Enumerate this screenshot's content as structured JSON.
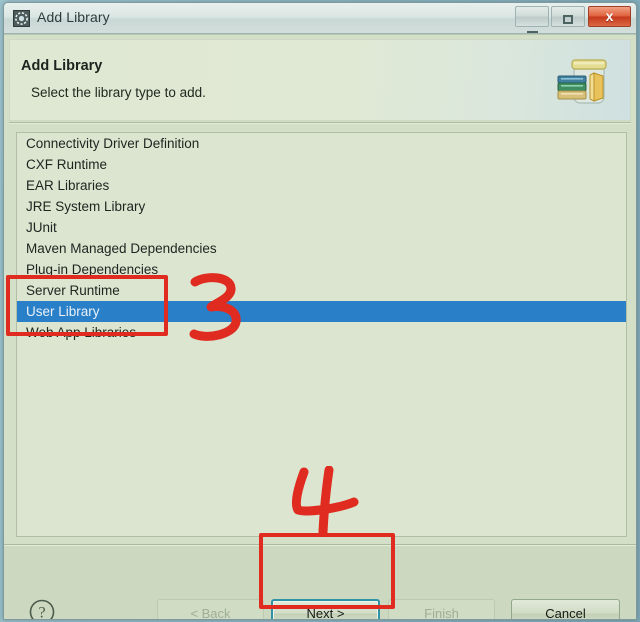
{
  "window": {
    "title": "Add Library",
    "icon": "eclipse-wizard-icon",
    "controls": {
      "minimize_label": "–",
      "maximize_label": "□",
      "close_label": "x"
    }
  },
  "banner": {
    "title": "Add Library",
    "description": "Select the library type to add.",
    "icon": "jar-library-icon"
  },
  "list": {
    "name": "library-type-list",
    "selected_index": 8,
    "items": [
      "Connectivity Driver Definition",
      "CXF Runtime",
      "EAR Libraries",
      "JRE System Library",
      "JUnit",
      "Maven Managed Dependencies",
      "Plug-in Dependencies",
      "Server Runtime",
      "User Library",
      "Web App Libraries"
    ]
  },
  "buttons": {
    "help_icon": "help-question-icon",
    "back": {
      "label": "< Back",
      "state": "disabled"
    },
    "next": {
      "label": "Next >",
      "state": "focused"
    },
    "finish": {
      "label": "Finish",
      "state": "disabled"
    },
    "cancel": {
      "label": "Cancel",
      "state": "enabled"
    }
  },
  "annotations": {
    "color": "#e02b20",
    "step3_label": "3",
    "step4_label": "4",
    "highlight_list_region": "Server Runtime / User Library / Web App Libraries",
    "highlight_button_region": "Next >"
  },
  "colors": {
    "desktop": "#8fb9c6",
    "dialog_bg": "#d3e0c7",
    "banner_bg": "#dfe8d2",
    "list_bg": "#dbe5cf",
    "selection": "#2a7fc9",
    "button_bar": "#ccd9c0",
    "annotation_red": "#e02b20",
    "close_button": "#c4391b",
    "focus_ring": "#2f93a8"
  }
}
